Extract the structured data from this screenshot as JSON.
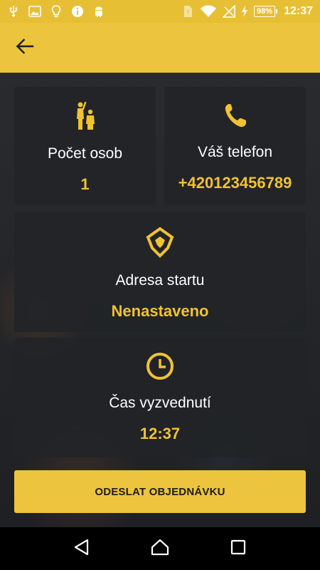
{
  "status_bar": {
    "battery": "98%",
    "time": "12:37"
  },
  "app_bar": {
    "back_icon": "arrow-left-icon"
  },
  "cards": {
    "persons": {
      "icon": "people-icon",
      "label": "Počet osob",
      "value": "1"
    },
    "phone": {
      "icon": "phone-icon",
      "label": "Váš telefon",
      "value": "+420123456789"
    },
    "address": {
      "icon": "pin-icon",
      "label": "Adresa startu",
      "value": "Nenastaveno"
    },
    "time": {
      "icon": "clock-icon",
      "label": "Čas vyzvednutí",
      "value": "12:37"
    }
  },
  "submit": {
    "label": "ODESLAT OBJEDNÁVKU"
  },
  "nav": {
    "back": "nav-back-icon",
    "home": "nav-home-icon",
    "recents": "nav-recents-icon"
  },
  "colors": {
    "accent": "#edc43d",
    "value_text": "#f1c232",
    "card_bg": "#222427"
  }
}
